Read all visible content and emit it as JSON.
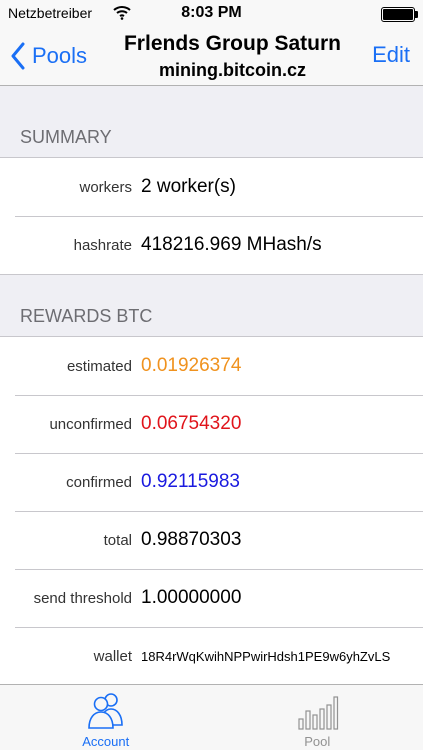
{
  "status_bar": {
    "carrier": "Netzbetreiber",
    "time": "8:03 PM"
  },
  "nav": {
    "back_label": "Pools",
    "title": "Frlends Group Saturn",
    "subtitle": "mining.bitcoin.cz",
    "edit_label": "Edit"
  },
  "summary": {
    "header": "SUMMARY",
    "rows": [
      {
        "key": "workers",
        "value": "2 worker(s)"
      },
      {
        "key": "hashrate",
        "value": "418216.969 MHash/s"
      }
    ]
  },
  "rewards": {
    "header": "REWARDS BTC",
    "rows": [
      {
        "key": "estimated",
        "value": "0.01926374",
        "color": "#f0921e"
      },
      {
        "key": "unconfirmed",
        "value": "0.06754320",
        "color": "#e0141b"
      },
      {
        "key": "confirmed",
        "value": "0.92115983",
        "color": "#1a1adf"
      },
      {
        "key": "total",
        "value": "0.98870303",
        "color": "#000000"
      },
      {
        "key": "send threshold",
        "value": "1.00000000",
        "color": "#000000"
      },
      {
        "key": "wallet",
        "value": "18R4rWqKwihNPPwirHdsh1PE9w6yhZvLS",
        "color": "#000000"
      }
    ]
  },
  "tabs": [
    {
      "label": "Account",
      "icon": "account-icon",
      "active": true
    },
    {
      "label": "Pool",
      "icon": "pool-bars-icon",
      "active": false
    }
  ],
  "colors": {
    "accent": "#1a6ff5",
    "inactive_tab": "#929292"
  }
}
